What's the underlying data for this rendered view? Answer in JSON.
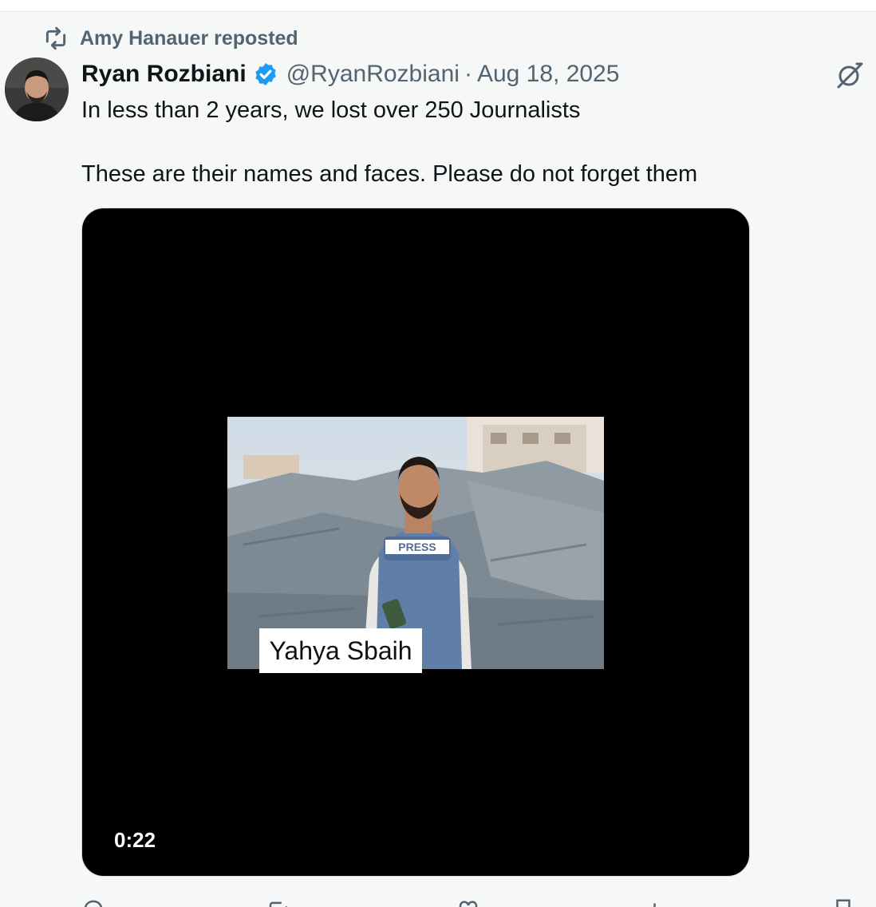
{
  "repost": {
    "label": "Amy Hanauer reposted",
    "icon": "repost-icon"
  },
  "tweet": {
    "display_name": "Ryan Rozbiani",
    "verified_icon": "verified-badge-icon",
    "handle": "@RyanRozbiani",
    "separator": "·",
    "date": "Aug 18, 2025",
    "text_lines": [
      "In less than 2 years, we lost over 250 Journalists",
      "These are their names and faces. Please do not forget them"
    ]
  },
  "media": {
    "caption": "Yahya Sbaih",
    "duration": "0:22",
    "vest_label": "PRESS"
  },
  "icons": {
    "grok": "grok-icon",
    "reply": "reply-icon",
    "retweet": "retweet-icon",
    "like": "like-icon",
    "views": "views-icon",
    "bookmark": "bookmark-icon"
  },
  "colors": {
    "accent": "#1d9bf0",
    "muted": "#536471",
    "text": "#0f1419",
    "background": "#f6f7f7"
  }
}
